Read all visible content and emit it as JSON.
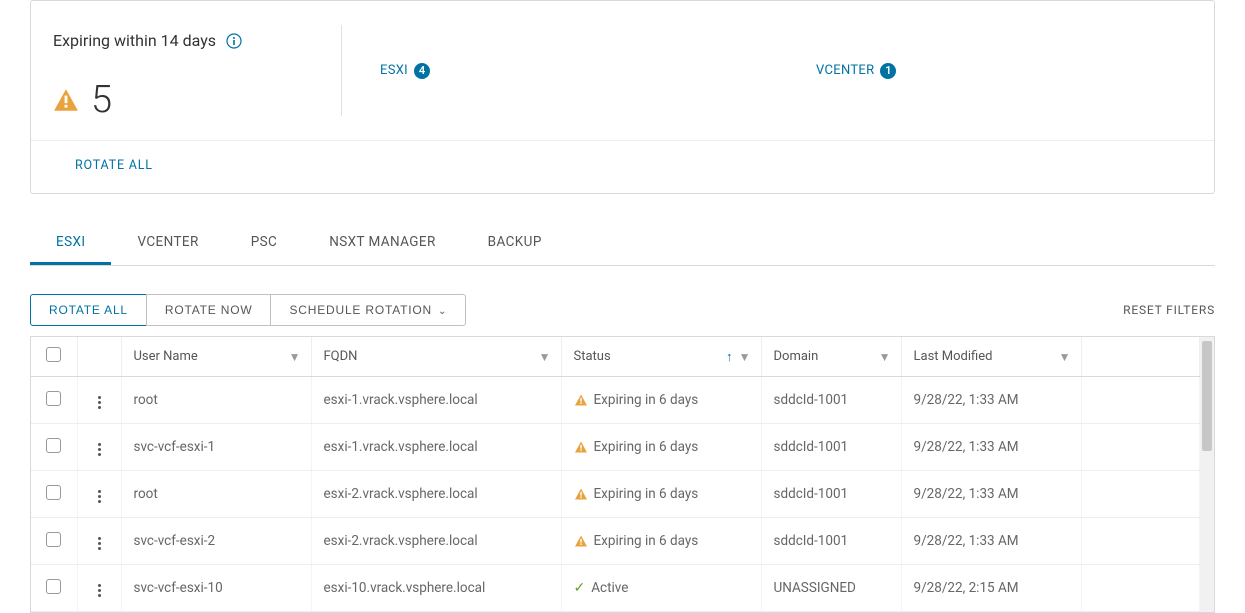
{
  "summary": {
    "title": "Expiring within 14 days",
    "count": "5",
    "rotate_all": "ROTATE ALL",
    "tiles": [
      {
        "label": "ESXI",
        "count": "4"
      },
      {
        "label": "VCENTER",
        "count": "1"
      }
    ]
  },
  "tabs": [
    {
      "label": "ESXI",
      "active": true
    },
    {
      "label": "VCENTER",
      "active": false
    },
    {
      "label": "PSC",
      "active": false
    },
    {
      "label": "NSXT MANAGER",
      "active": false
    },
    {
      "label": "BACKUP",
      "active": false
    }
  ],
  "toolbar": {
    "rotate_all": "ROTATE ALL",
    "rotate_now": "ROTATE NOW",
    "schedule": "SCHEDULE ROTATION",
    "reset_filters": "RESET FILTERS"
  },
  "columns": {
    "user": "User Name",
    "fqdn": "FQDN",
    "status": "Status",
    "domain": "Domain",
    "modified": "Last Modified"
  },
  "rows": [
    {
      "user": "root",
      "fqdn": "esxi-1.vrack.vsphere.local",
      "status": "Expiring in 6 days",
      "status_type": "warn",
      "domain": "sddcId-1001",
      "modified": "9/28/22, 1:33 AM"
    },
    {
      "user": "svc-vcf-esxi-1",
      "fqdn": "esxi-1.vrack.vsphere.local",
      "status": "Expiring in 6 days",
      "status_type": "warn",
      "domain": "sddcId-1001",
      "modified": "9/28/22, 1:33 AM"
    },
    {
      "user": "root",
      "fqdn": "esxi-2.vrack.vsphere.local",
      "status": "Expiring in 6 days",
      "status_type": "warn",
      "domain": "sddcId-1001",
      "modified": "9/28/22, 1:33 AM"
    },
    {
      "user": "svc-vcf-esxi-2",
      "fqdn": "esxi-2.vrack.vsphere.local",
      "status": "Expiring in 6 days",
      "status_type": "warn",
      "domain": "sddcId-1001",
      "modified": "9/28/22, 1:33 AM"
    },
    {
      "user": "svc-vcf-esxi-10",
      "fqdn": "esxi-10.vrack.vsphere.local",
      "status": "Active",
      "status_type": "ok",
      "domain": "UNASSIGNED",
      "modified": "9/28/22, 2:15 AM"
    }
  ]
}
